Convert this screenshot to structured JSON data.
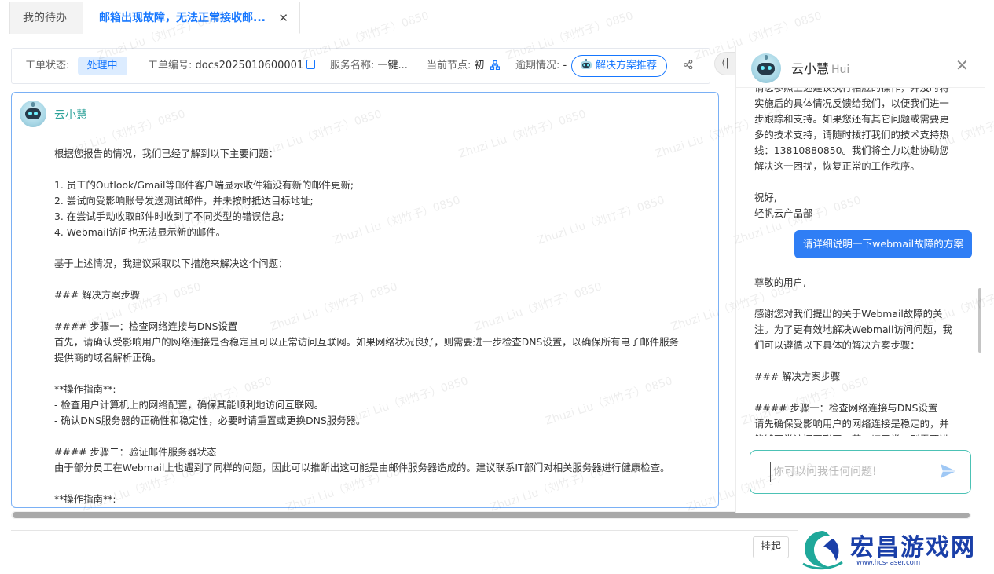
{
  "tabs": [
    {
      "label": "我的待办"
    },
    {
      "label": "邮箱出现故障，无法正常接收邮..."
    }
  ],
  "info": {
    "status_label": "工单状态:",
    "status_value": "处理中",
    "ticket_label": "工单编号:",
    "ticket_value": "docs2025010600001",
    "service_label": "服务名称:",
    "service_value": "一键...",
    "node_label": "当前节点:",
    "node_value": "初",
    "overdue_label": "逾期情况:",
    "overdue_value": "-",
    "recommend_button": "解决方案推荐"
  },
  "main_chat": {
    "bot_name": "云小慧",
    "lines": [
      "根据您报告的情况，我们已经了解到以下主要问题：",
      "",
      "1. 员工的Outlook/Gmail等邮件客户端显示收件箱没有新的邮件更新;",
      "2. 尝试向受影响账号发送测试邮件，并未按时抵达目标地址;",
      "3. 在尝试手动收取邮件时收到了不同类型的错误信息;",
      "4. Webmail访问也无法显示新的邮件。",
      "",
      "基于上述情况，我建议采取以下措施来解决这个问题：",
      "",
      "### 解决方案步骤",
      "",
      "#### 步骤一：检查网络连接与DNS设置",
      "首先，请确认受影响用户的网络连接是否稳定且可以正常访问互联网。如果网络状况良好，则需要进一步检查DNS设置，以确保所有电子邮件服务",
      "提供商的域名解析正确。",
      "",
      "**操作指南**:",
      "- 检查用户计算机上的网络配置，确保其能顺利地访问互联网。",
      "- 确认DNS服务器的正确性和稳定性，必要时请重置或更换DNS服务器。",
      "",
      "#### 步骤二：验证邮件服务器状态",
      "由于部分员工在Webmail上也遇到了同样的问题，因此可以推断出这可能是由邮件服务器造成的。建议联系IT部门对相关服务器进行健康检查。",
      "",
      "**操作指南**:"
    ]
  },
  "footer": {
    "hang_button": "挂起"
  },
  "side": {
    "title": "云小慧",
    "title_en": "Hui",
    "top_lines": [
      "请您参照上述建议执行相应的操作，并及时将",
      "实施后的具体情况反馈给我们，以便我们进一",
      "步跟踪和支持。如果您还有其它问题或需要更",
      "多的技术支持，请随时拨打我们的技术支持热",
      "线：13810880850。我们将全力以赴协助您",
      "解决这一困扰，恢复正常的工作秩序。",
      "",
      "祝好,",
      "轻帆云产品部"
    ],
    "user_message": "请详细说明一下webmail故障的方案",
    "reply_lines": [
      "尊敬的用户,",
      "",
      "感谢您对我们提出的关于Webmail故障的关",
      "注。为了更有效地解决Webmail访问问题，我",
      "们可以遵循以下具体的解决方案步骤：",
      "",
      "### 解决方案步骤",
      "",
      "#### 步骤一：检查网络连接与DNS设置",
      "请先确保受影响用户的网络连接是稳定的，并",
      "能够正常访问互联网。若一切正常，则需要进"
    ],
    "input_placeholder": "你可以问我任何问题!"
  },
  "watermark": "Zhuzi Liu（刘竹子）0850",
  "logo": {
    "text": "宏昌游戏网",
    "url": "www.hcs-laser.com"
  },
  "colors": {
    "accent": "#1677ff",
    "bot_green": "#2fa39a",
    "user_bubble": "#2f7ef5",
    "logo_blue": "#1a3fa8"
  }
}
